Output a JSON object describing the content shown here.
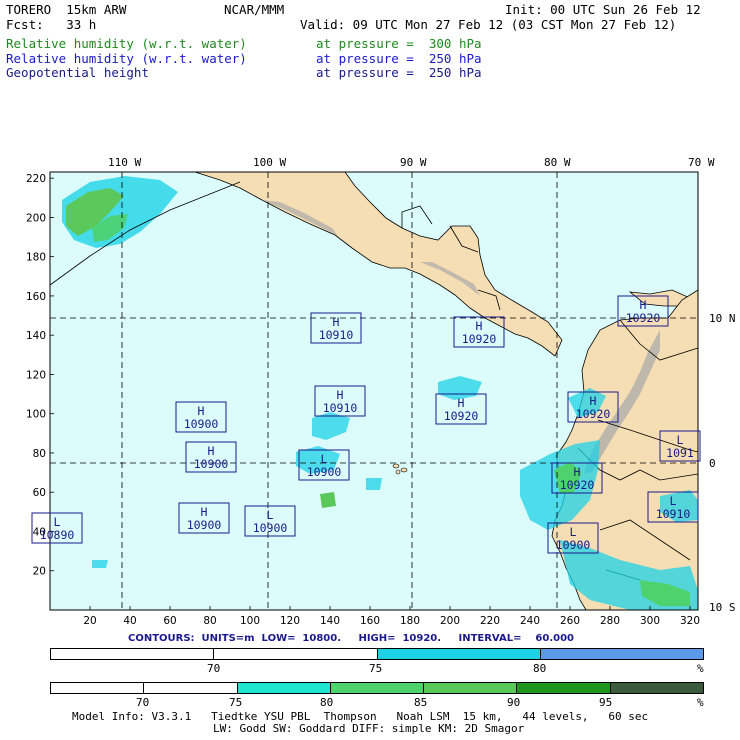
{
  "header": {
    "model": "TORERO  15km ARW",
    "center": "NCAR/MMM",
    "init": "Init: 00 UTC Sun 26 Feb 12",
    "fcst": "Fcst:   33 h",
    "valid": "Valid: 09 UTC Mon 27 Feb 12 (03 CST Mon 27 Feb 12)",
    "fields": [
      {
        "name": "Relative humidity (w.r.t. water)",
        "level": "at pressure =  300 hPa",
        "color": "#1e8a1e"
      },
      {
        "name": "Relative humidity (w.r.t. water)",
        "level": "at pressure =  250 hPa",
        "color": "#1a1acc"
      },
      {
        "name": "Geopotential height",
        "level": "at pressure =  250 hPa",
        "color": "#1a1a8c"
      }
    ]
  },
  "map": {
    "ocean_color": "#dcfcfc",
    "land_color": "#f5deb3",
    "lon_labels": [
      "110 W",
      "100 W",
      "90 W",
      "80 W",
      "70 W"
    ],
    "lat_labels": [
      "10 N",
      "0",
      "10 S"
    ],
    "y_ticks": [
      "220",
      "200",
      "180",
      "160",
      "140",
      "120",
      "100",
      "80",
      "60",
      "40",
      "20"
    ],
    "x_ticks": [
      "20",
      "40",
      "60",
      "80",
      "100",
      "120",
      "140",
      "160",
      "180",
      "200",
      "220",
      "240",
      "260",
      "280",
      "300",
      "320"
    ],
    "centers": [
      {
        "type": "H",
        "value": "10910"
      },
      {
        "type": "H",
        "value": "10920"
      },
      {
        "type": "H",
        "value": "10920"
      },
      {
        "type": "H",
        "value": "10900"
      },
      {
        "type": "H",
        "value": "10910"
      },
      {
        "type": "H",
        "value": "10920"
      },
      {
        "type": "H",
        "value": "10920"
      },
      {
        "type": "H",
        "value": "10900"
      },
      {
        "type": "L",
        "value": "10900"
      },
      {
        "type": "L",
        "value": "1091"
      },
      {
        "type": "H",
        "value": "10920"
      },
      {
        "type": "L",
        "value": "10890"
      },
      {
        "type": "H",
        "value": "10900"
      },
      {
        "type": "L",
        "value": "10900"
      },
      {
        "type": "L",
        "value": "10910"
      },
      {
        "type": "L",
        "value": "10900"
      }
    ]
  },
  "contours": {
    "label": "CONTOURS:",
    "units": "UNITS=m",
    "low": "LOW=  10800.",
    "high": "HIGH=  10920.",
    "interval": "INTERVAL=    60.000"
  },
  "bar250": {
    "colors": [
      "#ffffff",
      "#ffffff",
      "#1ed2e6",
      "#5a9ae8"
    ],
    "labels": [
      "70",
      "75",
      "80",
      "%"
    ]
  },
  "bar300": {
    "colors": [
      "#ffffff",
      "#ffffff",
      "#1ee6d2",
      "#4ed26e",
      "#5ac85a",
      "#1e961e",
      "#3c5a3c"
    ],
    "labels": [
      "70",
      "75",
      "80",
      "85",
      "90",
      "95",
      "%"
    ]
  },
  "footer": {
    "line1": "Model Info: V3.3.1   Tiedtke YSU PBL  Thompson   Noah LSM  15 km,   44 levels,   60 sec",
    "line2": "LW: Godd SW: Goddard DIFF: simple KM: 2D Smagor"
  }
}
